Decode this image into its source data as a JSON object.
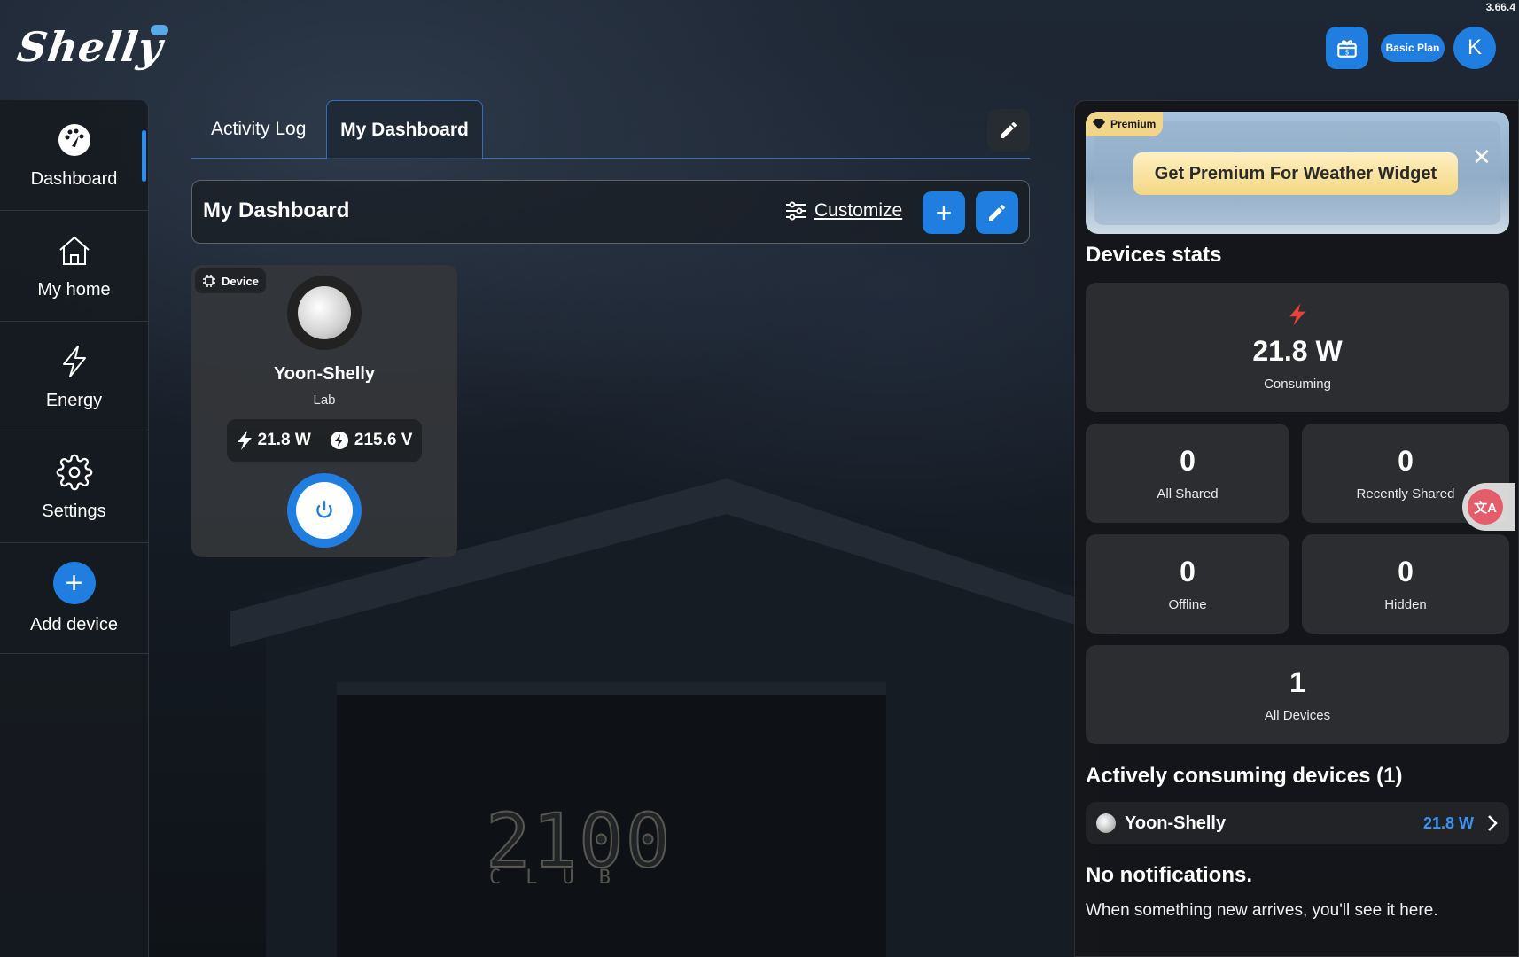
{
  "app": {
    "version": "3.66.4",
    "logo_text": "Shelly"
  },
  "header": {
    "plan_label": "Basic Plan",
    "avatar_letter": "K"
  },
  "sidebar": {
    "items": [
      {
        "label": "Dashboard",
        "icon": "dashboard-gauge-icon",
        "active": true
      },
      {
        "label": "My home",
        "icon": "home-icon"
      },
      {
        "label": "Energy",
        "icon": "lightning-icon"
      },
      {
        "label": "Settings",
        "icon": "gear-icon"
      },
      {
        "label": "Add device",
        "icon": "plus-icon"
      }
    ]
  },
  "tabs": {
    "activity_log": "Activity Log",
    "my_dashboard": "My Dashboard"
  },
  "dashboard": {
    "title": "My Dashboard",
    "customize_label": "Customize"
  },
  "device_card": {
    "tag": "Device",
    "name": "Yoon-Shelly",
    "room": "Lab",
    "power": "21.8 W",
    "voltage": "215.6 V",
    "state": "on"
  },
  "promo": {
    "badge": "Premium",
    "cta": "Get Premium For Weather Widget",
    "close": "✕"
  },
  "devices_stats": {
    "title": "Devices stats",
    "consuming": {
      "value": "21.8 W",
      "label": "Consuming"
    },
    "all_shared": {
      "value": "0",
      "label": "All Shared"
    },
    "recently_shared": {
      "value": "0",
      "label": "Recently Shared"
    },
    "offline": {
      "value": "0",
      "label": "Offline"
    },
    "hidden": {
      "value": "0",
      "label": "Hidden"
    },
    "all_devices": {
      "value": "1",
      "label": "All Devices"
    }
  },
  "active_devices": {
    "title": "Actively consuming devices (1)",
    "items": [
      {
        "name": "Yoon-Shelly",
        "power": "21.8 W"
      }
    ]
  },
  "notifications": {
    "title": "No notifications.",
    "text": "When something new arrives, you'll see it here."
  },
  "background": {
    "sign_number": "2100",
    "sign_sub": "CLUB"
  },
  "colors": {
    "accent": "#1f7ee0",
    "premium": "#f1d58a",
    "energy_red": "#e8413c",
    "watts_blue": "#3b93f5"
  }
}
